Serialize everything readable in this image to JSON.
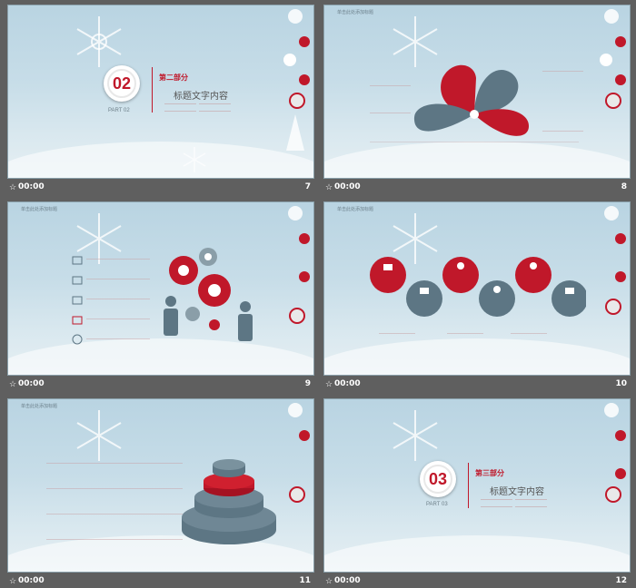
{
  "slides": [
    {
      "number": "7",
      "time": "00:00",
      "star": "☆",
      "badge": "02",
      "section": "第二部分",
      "title": "标题文字内容",
      "part": "PART 02"
    },
    {
      "number": "8",
      "time": "00:00",
      "star": "☆",
      "header": "单击此处添加标题"
    },
    {
      "number": "9",
      "time": "00:00",
      "star": "☆",
      "header": "单击此处添加标题"
    },
    {
      "number": "10",
      "time": "00:00",
      "star": "☆",
      "header": "单击此处添加标题"
    },
    {
      "number": "11",
      "time": "00:00",
      "star": "☆",
      "header": "单击此处添加标题"
    },
    {
      "number": "12",
      "time": "00:00",
      "star": "☆",
      "badge": "03",
      "section": "第三部分",
      "title": "标题文字内容",
      "part": "PART 03"
    }
  ],
  "colors": {
    "background": "#5f5f5f",
    "accent": "#c0182a",
    "slate": "#5d7684"
  }
}
